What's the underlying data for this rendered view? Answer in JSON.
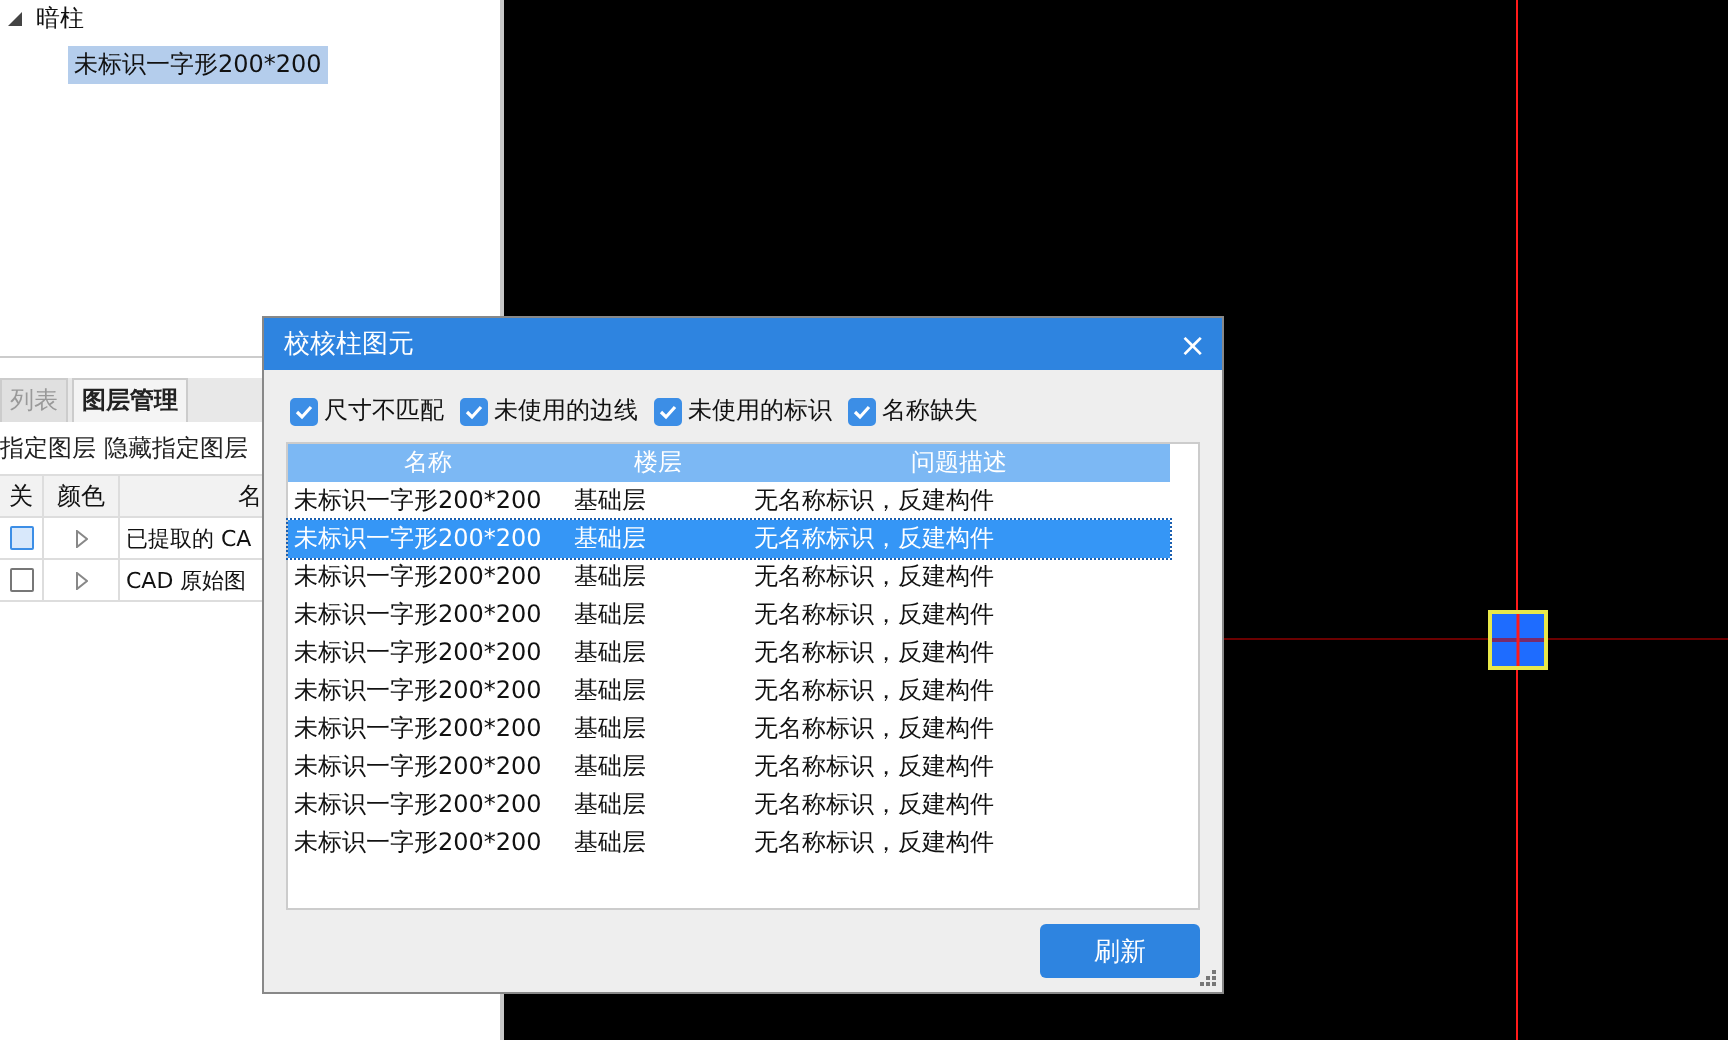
{
  "tree": {
    "label": "暗柱",
    "expanded": true,
    "children": [
      {
        "label": "未标识一字形200*200",
        "selected": true
      }
    ]
  },
  "layer_panel": {
    "tabs": [
      {
        "label": "列表",
        "selected": false
      },
      {
        "label": "图层管理",
        "selected": true
      }
    ],
    "toolbar": [
      "指定图层",
      "隐藏指定图层"
    ],
    "columns": [
      "关",
      "颜色",
      "名"
    ],
    "rows": [
      {
        "on": true,
        "name": "已提取的 CA"
      },
      {
        "on": false,
        "name": "CAD 原始图"
      }
    ]
  },
  "dialog": {
    "title": "校核柱图元",
    "close": "×",
    "filters": [
      {
        "label": "尺寸不匹配",
        "checked": true
      },
      {
        "label": "未使用的边线",
        "checked": true
      },
      {
        "label": "未使用的标识",
        "checked": true
      },
      {
        "label": "名称缺失",
        "checked": true
      }
    ],
    "columns": [
      "名称",
      "楼层",
      "问题描述"
    ],
    "rows": [
      {
        "name": "未标识一字形200*200",
        "floor": "基础层",
        "issue": "无名称标识，反建构件",
        "selected": false
      },
      {
        "name": "未标识一字形200*200",
        "floor": "基础层",
        "issue": "无名称标识，反建构件",
        "selected": true
      },
      {
        "name": "未标识一字形200*200",
        "floor": "基础层",
        "issue": "无名称标识，反建构件",
        "selected": false
      },
      {
        "name": "未标识一字形200*200",
        "floor": "基础层",
        "issue": "无名称标识，反建构件",
        "selected": false
      },
      {
        "name": "未标识一字形200*200",
        "floor": "基础层",
        "issue": "无名称标识，反建构件",
        "selected": false
      },
      {
        "name": "未标识一字形200*200",
        "floor": "基础层",
        "issue": "无名称标识，反建构件",
        "selected": false
      },
      {
        "name": "未标识一字形200*200",
        "floor": "基础层",
        "issue": "无名称标识，反建构件",
        "selected": false
      },
      {
        "name": "未标识一字形200*200",
        "floor": "基础层",
        "issue": "无名称标识，反建构件",
        "selected": false
      },
      {
        "name": "未标识一字形200*200",
        "floor": "基础层",
        "issue": "无名称标识，反建构件",
        "selected": false
      },
      {
        "name": "未标识一字形200*200",
        "floor": "基础层",
        "issue": "无名称标识，反建构件",
        "selected": false
      }
    ],
    "button": "刷新"
  }
}
